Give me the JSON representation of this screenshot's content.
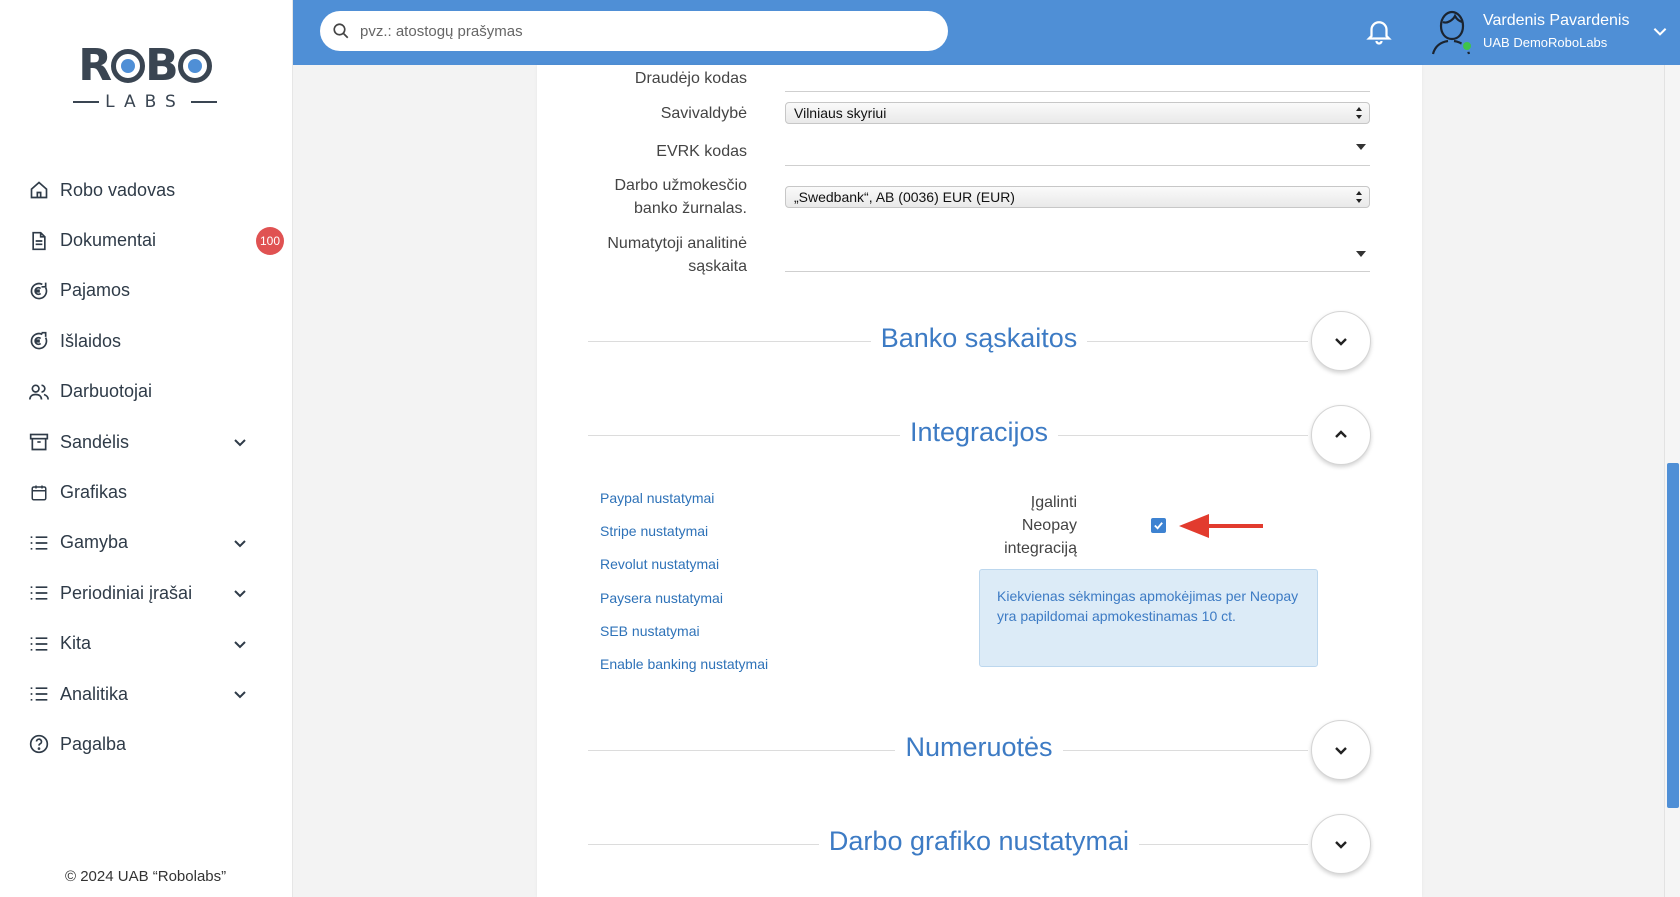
{
  "sidebar": {
    "logo": {
      "top": "ROBO",
      "bottom": "LABS"
    },
    "items": [
      {
        "label": "Robo vadovas",
        "icon": "home-icon"
      },
      {
        "label": "Dokumentai",
        "icon": "document-icon",
        "badge": "100"
      },
      {
        "label": "Pajamos",
        "icon": "euro-income-icon"
      },
      {
        "label": "Išlaidos",
        "icon": "euro-expense-icon"
      },
      {
        "label": "Darbuotojai",
        "icon": "users-icon"
      },
      {
        "label": "Sandėlis",
        "icon": "archive-icon",
        "expandable": true
      },
      {
        "label": "Grafikas",
        "icon": "calendar-icon"
      },
      {
        "label": "Gamyba",
        "icon": "list-icon",
        "expandable": true
      },
      {
        "label": "Periodiniai įrašai",
        "icon": "list-icon",
        "expandable": true
      },
      {
        "label": "Kita",
        "icon": "list-icon",
        "expandable": true
      },
      {
        "label": "Analitika",
        "icon": "list-icon",
        "expandable": true
      },
      {
        "label": "Pagalba",
        "icon": "help-icon"
      }
    ],
    "copyright": "© 2024 UAB “Robolabs”"
  },
  "header": {
    "search_placeholder": "pvz.: atostogų prašymas",
    "user_name": "Vardenis Pavardenis",
    "user_company": "UAB DemoRoboLabs",
    "accent": "#4f8fd6"
  },
  "form": {
    "draudejo_kodas": {
      "label": "Draudėjo kodas",
      "value": ""
    },
    "savivaldybe": {
      "label": "Savivaldybė",
      "value": "Vilniaus skyriui"
    },
    "evrk": {
      "label": "EVRK kodas",
      "value": ""
    },
    "darbo_uzmokescio": {
      "label_line1": "Darbo užmokesčio",
      "label_line2": "banko žurnalas.",
      "value": "„Swedbank“, AB (0036) EUR (EUR)"
    },
    "analitine": {
      "label_line1": "Numatytoji analitinė",
      "label_line2": "sąskaita",
      "value": ""
    }
  },
  "sections": {
    "banko": {
      "title": "Banko sąskaitos",
      "state": "collapsed"
    },
    "integracijos": {
      "title": "Integracijos",
      "state": "expanded"
    },
    "numeruotes": {
      "title": "Numeruotės",
      "state": "collapsed"
    },
    "darbo_grafiko": {
      "title": "Darbo grafiko nustatymai",
      "state": "collapsed"
    }
  },
  "integrations": {
    "links": [
      "Paypal nustatymai",
      "Stripe nustatymai",
      "Revolut nustatymai",
      "Paysera nustatymai",
      "SEB nustatymai",
      "Enable banking nustatymai"
    ],
    "neopay_label_line1": "Įgalinti",
    "neopay_label_line2": "Neopay",
    "neopay_label_line3": "integraciją",
    "neopay_enabled": true,
    "info_text": "Kiekvienas sėkmingas apmokėjimas per Neopay yra papildomai apmokestinamas 10 ct."
  }
}
